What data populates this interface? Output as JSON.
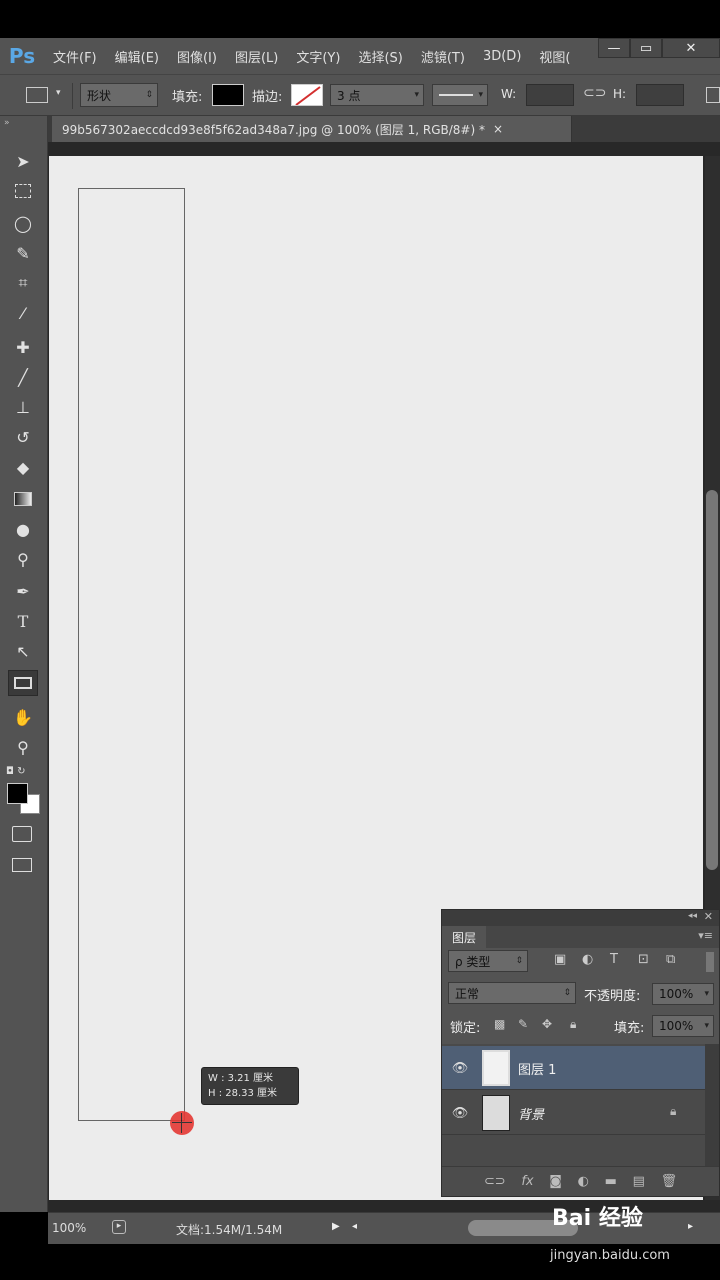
{
  "app": {
    "logo": "Ps"
  },
  "menu": {
    "items": [
      "文件(F)",
      "编辑(E)",
      "图像(I)",
      "图层(L)",
      "文字(Y)",
      "选择(S)",
      "滤镜(T)",
      "3D(D)",
      "视图("
    ],
    "window_buttons": [
      "—",
      "▭",
      "✕"
    ]
  },
  "options": {
    "shape_mode": "形状",
    "fill_label": "填充:",
    "fill_color": "#000000",
    "stroke_label": "描边:",
    "stroke_width": "3 点",
    "w_label": "W:",
    "h_label": "H:"
  },
  "document": {
    "tab_title": "99b567302aeccdcd93e8f5f62ad348a7.jpg @ 100% (图层 1, RGB/8#) *",
    "tab_close": "×"
  },
  "tools": {
    "list": [
      "move-icon",
      "marquee-icon",
      "lasso-icon",
      "quick-select-icon",
      "crop-icon",
      "eyedropper-icon",
      "healing-icon",
      "brush-icon",
      "stamp-icon",
      "history-brush-icon",
      "eraser-icon",
      "gradient-icon",
      "blur-icon",
      "dodge-icon",
      "pen-icon",
      "type-icon",
      "path-select-icon",
      "rectangle-icon",
      "hand-icon",
      "zoom-icon"
    ]
  },
  "tooltip": {
    "w_line": "W :   3.21 厘米",
    "h_line": "H :  28.33 厘米"
  },
  "layers_panel": {
    "tab_label": "图层",
    "filter_label": "ρ 类型",
    "blend_mode": "正常",
    "opacity_label": "不透明度:",
    "opacity_value": "100%",
    "lock_label": "锁定:",
    "fill_label": "填充:",
    "fill_value": "100%",
    "layers": [
      {
        "name": "图层 1",
        "selected": true
      },
      {
        "name": "背景",
        "locked": true
      }
    ],
    "footer_icons": [
      "link-icon",
      "fx-icon",
      "mask-icon",
      "adjustment-icon",
      "folder-icon",
      "new-layer-icon",
      "trash-icon"
    ]
  },
  "status": {
    "zoom": "100%",
    "doc_info": "文档:1.54M/1.54M"
  },
  "watermark": {
    "brand": "Bai 经验",
    "url": "jingyan.baidu.com"
  }
}
